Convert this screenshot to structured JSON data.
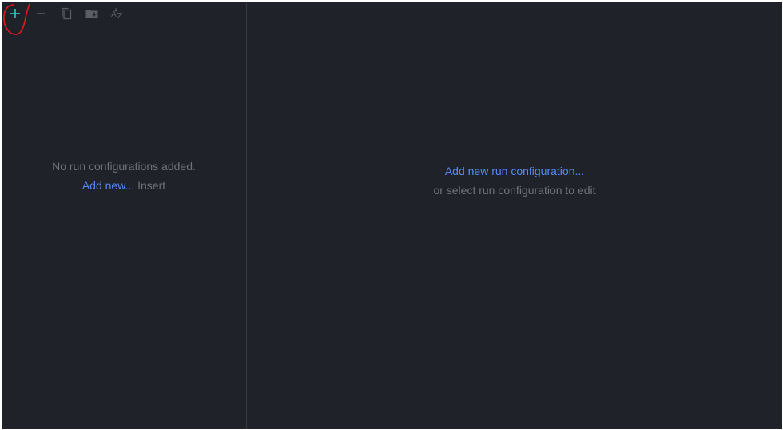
{
  "toolbar": {
    "buttons": [
      {
        "name": "add-icon",
        "tooltip": ""
      },
      {
        "name": "remove-icon",
        "tooltip": ""
      },
      {
        "name": "copy-icon",
        "tooltip": ""
      },
      {
        "name": "new-folder-icon",
        "tooltip": ""
      },
      {
        "name": "sort-alphabetically-icon",
        "tooltip": ""
      }
    ]
  },
  "left": {
    "empty_text": "No run configurations added.",
    "add_link": "Add new...",
    "shortcut": "Insert"
  },
  "right": {
    "add_link": "Add new run configuration...",
    "hint": "or select run configuration to edit"
  },
  "colors": {
    "background": "#1f2229",
    "border": "#393b40",
    "muted_text": "#6f737a",
    "link": "#548af7",
    "add_icon": "#3fc1c9",
    "annotation": "#e0181e"
  }
}
